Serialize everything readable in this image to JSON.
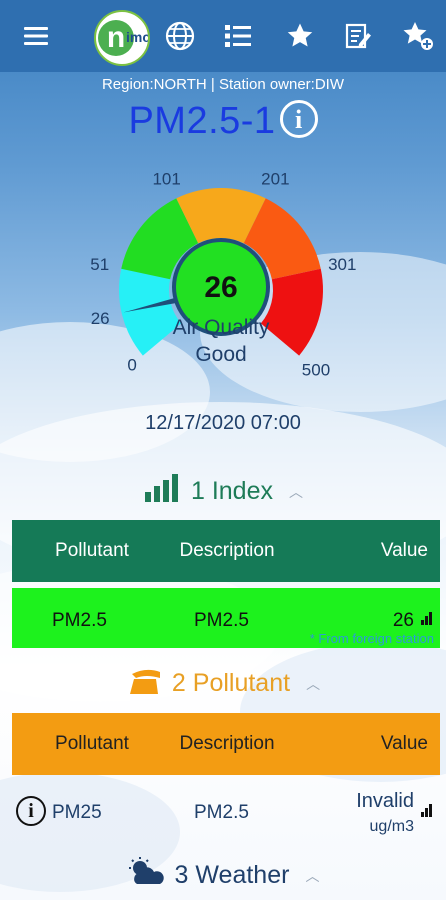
{
  "topbar": {
    "menu_icon": "hamburger-menu-icon",
    "logo_text": "n",
    "logo_sub": "imc",
    "icons": [
      "globe-icon",
      "list-icon",
      "star-icon",
      "edit-note-icon",
      "star-add-icon"
    ]
  },
  "station": {
    "region_line": "Region:NORTH | Station owner:DIW",
    "name": "PM2.5-1",
    "info_icon": "info-icon"
  },
  "gauge": {
    "value": "26",
    "value_num": 26,
    "label": "Air Quality",
    "status": "Good",
    "ticks": [
      "0",
      "26",
      "51",
      "101",
      "201",
      "301",
      "500"
    ],
    "colors": {
      "good": "#26f0f6",
      "moderate": "#22dd22",
      "usg": "#f7a81b",
      "unhealthy": "#fa5a12",
      "very_unhealthy": "#ee1111",
      "center": "#22e022"
    }
  },
  "datetime": "12/17/2020 07:00",
  "index_section": {
    "title": "1 Index",
    "headers": [
      "Pollutant",
      "Description",
      "Value"
    ],
    "row": {
      "pollutant": "PM2.5",
      "description": "PM2.5",
      "value": "26",
      "note": "* From foreign station"
    }
  },
  "pollutant_section": {
    "title": "2 Pollutant",
    "headers": [
      "Pollutant",
      "Description",
      "Value"
    ],
    "row": {
      "pollutant": "PM25",
      "description": "PM2.5",
      "value": "Invalid",
      "unit": "ug/m3"
    }
  },
  "weather_section": {
    "title": "3 Weather"
  }
}
